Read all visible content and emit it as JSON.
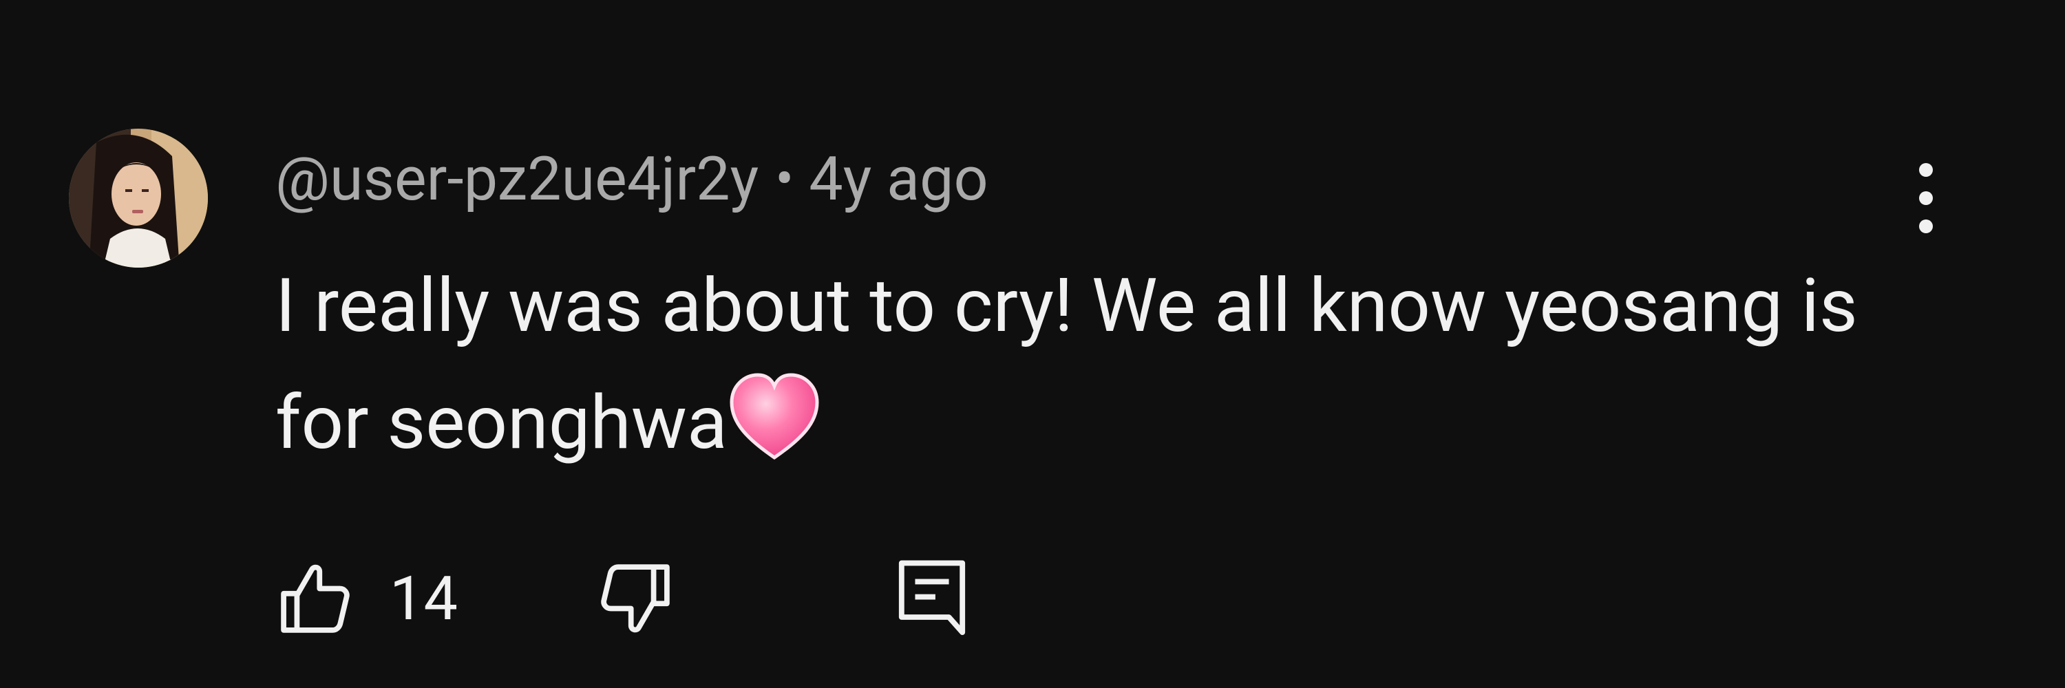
{
  "comment": {
    "username": "@user-pz2ue4jr2y",
    "separator": "•",
    "timestamp": "4y ago",
    "text": "I really was about to cry! We all know yeosang is for seonghwa",
    "emoji": "heart-emoji",
    "avatar": "avatar-photo"
  },
  "actions": {
    "like_icon": "thumbs-up-icon",
    "like_count": "14",
    "dislike_icon": "thumbs-down-icon",
    "reply_icon": "reply-comment-icon",
    "menu_icon": "more-vertical-icon"
  },
  "colors": {
    "background": "#0f0f0f",
    "text_primary": "#f1f1f1",
    "text_secondary": "#aaaaaa",
    "heart": "#ff6fa6"
  }
}
